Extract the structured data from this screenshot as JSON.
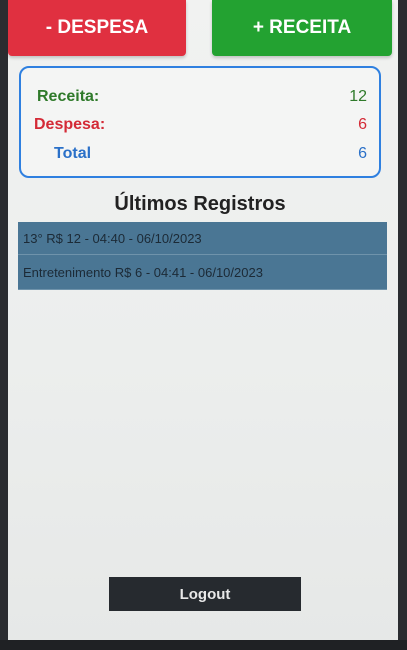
{
  "buttons": {
    "despesa_label": "- DESPESA",
    "receita_label": "+ RECEITA",
    "logout_label": "Logout"
  },
  "summary": {
    "receita_label": "Receita:",
    "receita_value": "12",
    "despesa_label": "Despesa:",
    "despesa_value": "6",
    "total_label": "Total",
    "total_value": "6"
  },
  "section_title": "Últimos Registros",
  "records": [
    "13° R$ 12 - 04:40 - 06/10/2023",
    "Entretenimento R$ 6 - 04:41 - 06/10/2023"
  ],
  "colors": {
    "despesa": "#e03040",
    "receita": "#23a231",
    "card_border": "#2f80e0",
    "record_bg": "#4a7694",
    "logout_bg": "#262a2f"
  }
}
